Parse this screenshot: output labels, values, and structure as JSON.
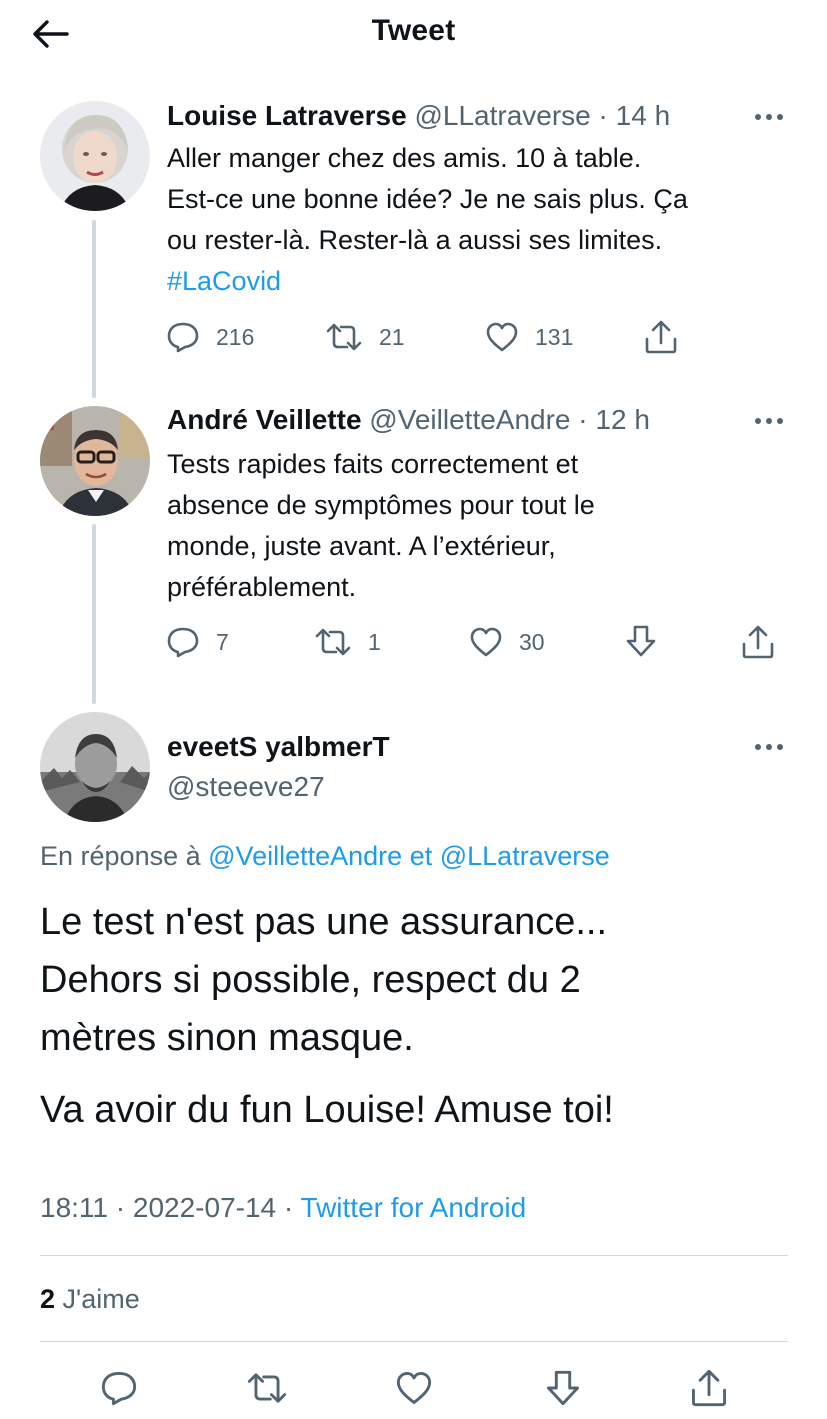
{
  "header": {
    "title": "Tweet",
    "back_icon": "arrow-left-icon"
  },
  "tweets": [
    {
      "name": "Louise Latraverse",
      "handle": "@LLatraverse",
      "time": "14 h",
      "lines": [
        "Aller manger chez des amis. 10 à table.",
        "Est-ce une bonne idée? Je ne sais plus. Ça",
        "ou rester-là. Rester-là a aussi ses limites."
      ],
      "hashtag": "#LaCovid",
      "replies": "216",
      "retweets": "21",
      "likes": "131"
    },
    {
      "name": "André Veillette",
      "handle": "@VeilletteAndre",
      "time": "12 h",
      "lines": [
        "Tests rapides faits correctement et",
        "absence de symptômes pour tout le",
        "monde, juste avant. A l’extérieur,",
        "préférablement."
      ],
      "replies": "7",
      "retweets": "1",
      "likes": "30"
    }
  ],
  "main_tweet": {
    "name": "eveetS yalbmerT",
    "handle": "@steeeve27",
    "reply_prefix": "En réponse à",
    "reply_mention_1": "@VeilletteAndre",
    "reply_and": "et",
    "reply_mention_2": "@LLatraverse",
    "body_lines": [
      "Le test n'est pas une assurance...",
      "Dehors si possible, respect du 2",
      "mètres sinon masque."
    ],
    "body_line_2": "Va avoir du fun Louise! Amuse toi!",
    "time": "18:11",
    "date": "2022-07-14",
    "source": "Twitter for Android",
    "likes_count": "2",
    "likes_label": "J'aime"
  },
  "separator": "·",
  "colors": {
    "text": "#0f1419",
    "secondary": "#536471",
    "accent": "#1d9bf0",
    "border": "#cfd9de"
  },
  "icons": {
    "reply": "comment-icon",
    "retweet": "retweet-icon",
    "like": "heart-icon",
    "bookmark": "bookmark-download-icon",
    "share": "share-icon",
    "more": "more-dots-icon"
  }
}
